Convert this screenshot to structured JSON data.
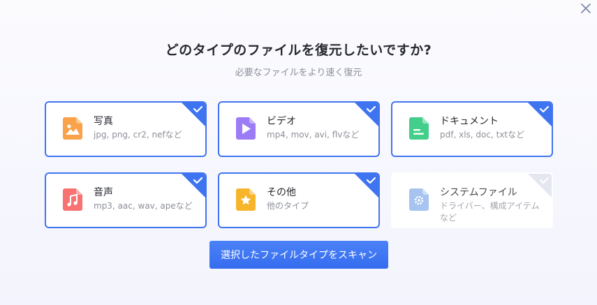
{
  "header": {
    "title": "どのタイプのファイルを復元したいですか?",
    "subtitle": "必要なファイルをより速く復元"
  },
  "cards": [
    {
      "name": "写真",
      "desc": "jpg, png, cr2, nefなど",
      "icon": "image-icon",
      "color": "#f9a24a",
      "selected": true
    },
    {
      "name": "ビデオ",
      "desc": "mp4, mov, avi, flvなど",
      "icon": "play-icon",
      "color": "#9b7cf6",
      "selected": true
    },
    {
      "name": "ドキュメント",
      "desc": "pdf, xls, doc, txtなど",
      "icon": "document-icon",
      "color": "#43cf8b",
      "selected": true
    },
    {
      "name": "音声",
      "desc": "mp3, aac, wav, apeなど",
      "icon": "music-icon",
      "color": "#f87272",
      "selected": true
    },
    {
      "name": "その他",
      "desc": "他のタイプ",
      "icon": "star-icon",
      "color": "#f7b52c",
      "selected": true
    },
    {
      "name": "システムファイル",
      "desc": "ドライバー、構成アイテムなど",
      "icon": "gear-icon",
      "color": "#a6c4ef",
      "selected": false
    }
  ],
  "actions": {
    "scan_label": "選択したファイルタイプをスキャン"
  },
  "colors": {
    "accent": "#3f74f0",
    "button": "#3f74f0"
  }
}
